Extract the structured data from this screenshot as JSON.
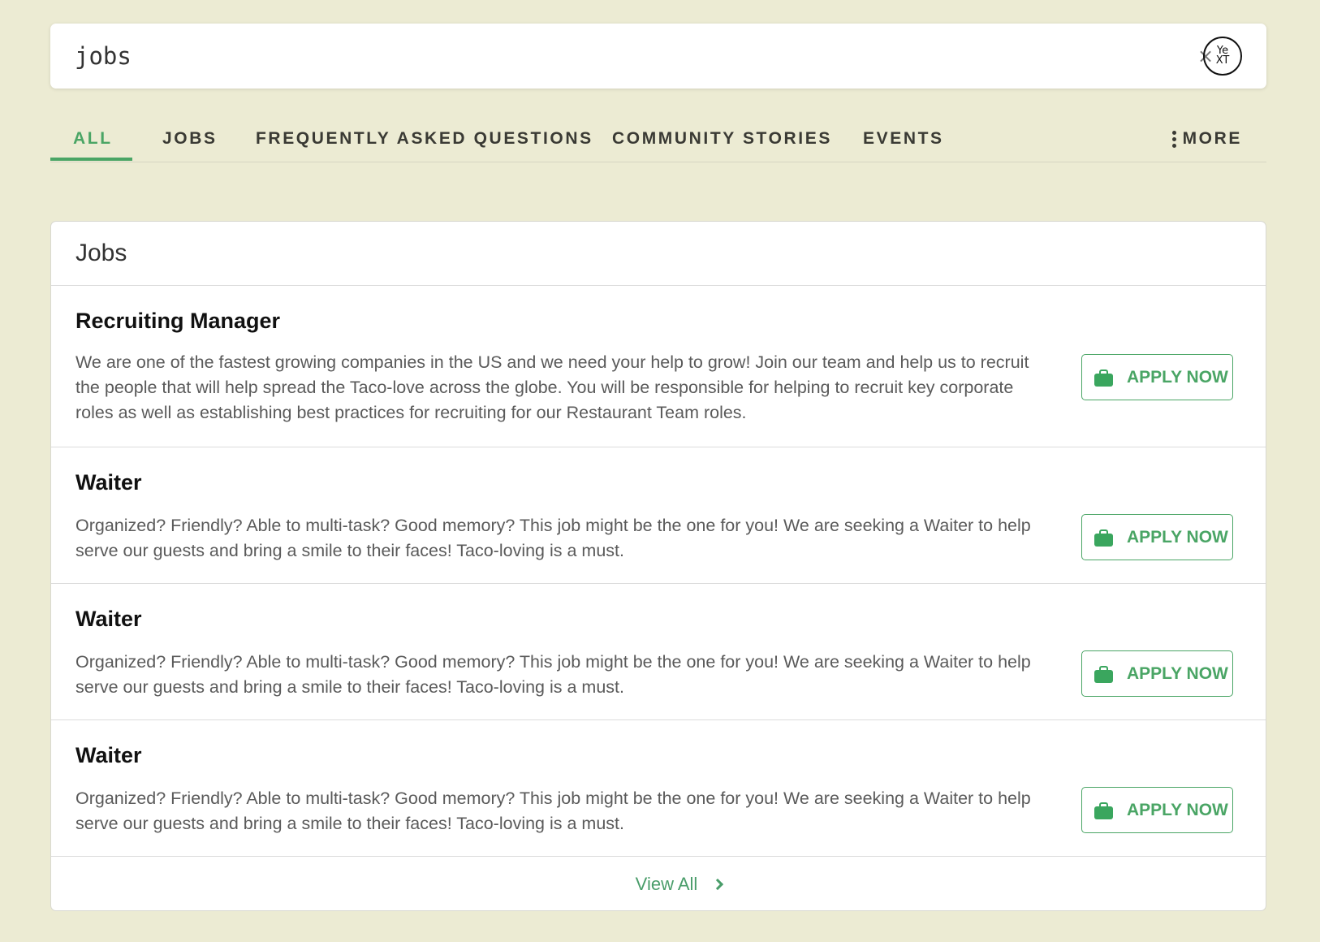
{
  "search": {
    "query": "jobs",
    "clear_icon": "×",
    "logo_top": "Ye",
    "logo_bottom": "XT"
  },
  "tabs": [
    {
      "label": "ALL",
      "active": true
    },
    {
      "label": "JOBS",
      "active": false
    },
    {
      "label": "FREQUENTLY ASKED QUESTIONS",
      "active": false
    },
    {
      "label": "COMMUNITY STORIES",
      "active": false
    },
    {
      "label": "EVENTS",
      "active": false
    }
  ],
  "more_label": "MORE",
  "section": {
    "title": "Jobs",
    "jobs": [
      {
        "title": "Recruiting Manager",
        "description": "We are one of the fastest growing companies in the US and we need your help to grow! Join our team and help us to recruit the people that will help spread the Taco-love across the globe. You will be responsible for helping to recruit key corporate roles as well as establishing best practices for recruiting for our Restaurant Team roles.",
        "cta": "APPLY NOW"
      },
      {
        "title": "Waiter",
        "description": "Organized? Friendly? Able to multi-task? Good memory? This job might be the one for you! We are seeking a Waiter to help serve our guests and bring a smile to their faces! Taco-loving is a must.",
        "cta": "APPLY NOW"
      },
      {
        "title": "Waiter",
        "description": "Organized? Friendly? Able to multi-task? Good memory? This job might be the one for you! We are seeking a Waiter to help serve our guests and bring a smile to their faces! Taco-loving is a must.",
        "cta": "APPLY NOW"
      },
      {
        "title": "Waiter",
        "description": "Organized? Friendly? Able to multi-task? Good memory? This job might be the one for you! We are seeking a Waiter to help serve our guests and bring a smile to their faces! Taco-loving is a must.",
        "cta": "APPLY NOW"
      }
    ],
    "view_all": "View All"
  },
  "colors": {
    "background": "#ecebd3",
    "accent": "#4aa565",
    "text_dark": "#3a3a34"
  }
}
